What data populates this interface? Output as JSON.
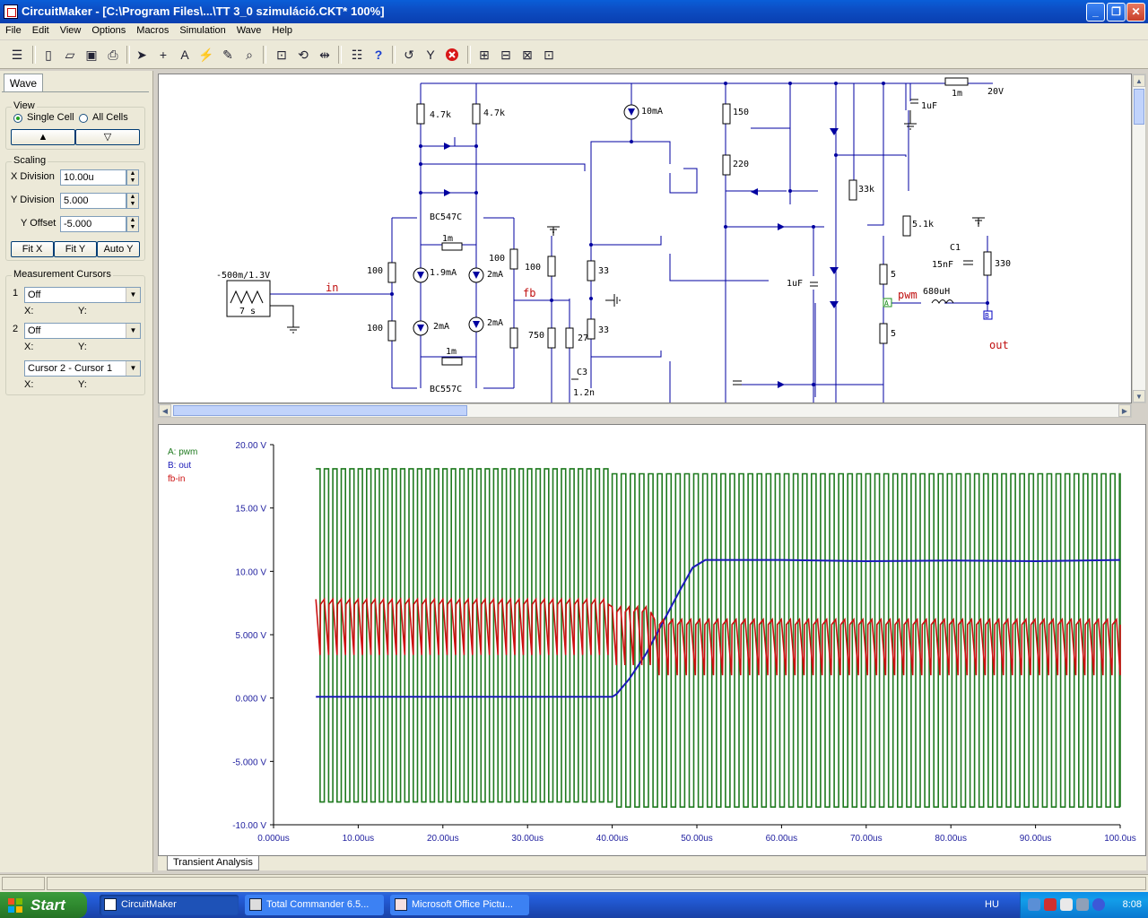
{
  "window": {
    "title": "CircuitMaker - [C:\\Program Files\\...\\TT 3_0 szimuláció.CKT* 100%]",
    "minimize": "_",
    "restore": "❐",
    "close": "✕"
  },
  "menu": [
    "File",
    "Edit",
    "View",
    "Options",
    "Macros",
    "Simulation",
    "Wave",
    "Help"
  ],
  "panel": {
    "tab": "Wave",
    "view": {
      "legend": "View",
      "single_cell": "Single Cell",
      "all_cells": "All Cells",
      "selected": "Single Cell",
      "up": "▲",
      "down": "▽"
    },
    "scaling": {
      "legend": "Scaling",
      "x_division_label": "X Division",
      "x_division": "10.00u",
      "y_division_label": "Y Division",
      "y_division": "5.000",
      "y_offset_label": "Y Offset",
      "y_offset": "-5.000",
      "fit_x": "Fit X",
      "fit_y": "Fit Y",
      "auto_y": "Auto Y"
    },
    "cursors": {
      "legend": "Measurement Cursors",
      "c1_num": "1",
      "c1_value": "Off",
      "c2_num": "2",
      "c2_value": "Off",
      "diff_value": "Cursor 2 - Cursor 1",
      "x_label": "X:",
      "y_label": "Y:"
    }
  },
  "schematic": {
    "labels": [
      "4.7k",
      "4.7k",
      "10mA",
      "150",
      "220",
      "1m",
      "20V",
      "1uF",
      "BC547C",
      "1m",
      "100",
      "1.9mA",
      "2mA",
      "100",
      "100",
      "33",
      "33k",
      "5.1k",
      "1uF",
      "5",
      "C1",
      "15nF",
      "330",
      "-500m/1.3V",
      "7 s",
      "in",
      "fb",
      "100",
      "2mA",
      "2mA",
      "1m",
      "750",
      "27",
      "C3",
      "1.2n",
      "33",
      "BC557C",
      "pwm",
      "680uH",
      "5",
      "out"
    ],
    "probe_a": "A",
    "probe_b": "B"
  },
  "chart_data": {
    "type": "line",
    "title": "",
    "xlabel": "",
    "ylabel": "",
    "x_ticks": [
      "0.000us",
      "10.00us",
      "20.00us",
      "30.00us",
      "40.00us",
      "50.00us",
      "60.00us",
      "70.00us",
      "80.00us",
      "90.00us",
      "100.0us"
    ],
    "y_ticks": [
      "20.00 V",
      "15.00 V",
      "10.00 V",
      "5.000 V",
      "0.000 V",
      "-5.000 V",
      "-10.00 V"
    ],
    "xlim": [
      0,
      100
    ],
    "ylim": [
      -10,
      20
    ],
    "legend_position": "top-left",
    "series": [
      {
        "name": "A: pwm",
        "color": "#1f7a1f",
        "kind": "square",
        "start": 5.0,
        "end": 100,
        "period": 1.0,
        "segments": [
          {
            "from": 5.0,
            "to": 40.0,
            "high": 18.1,
            "low": -8.2,
            "period": 1.0
          },
          {
            "from": 40.0,
            "to": 100,
            "high": 17.7,
            "low": -8.6,
            "period": 1.07
          }
        ]
      },
      {
        "name": "B: out",
        "color": "#1a1ab8",
        "kind": "line",
        "points": [
          [
            5,
            0.1
          ],
          [
            40,
            0.1
          ],
          [
            40.5,
            0.3
          ],
          [
            42,
            1.5
          ],
          [
            44,
            3.5
          ],
          [
            46,
            6.0
          ],
          [
            48,
            8.5
          ],
          [
            49.5,
            10.3
          ],
          [
            51,
            10.9
          ],
          [
            60,
            10.9
          ],
          [
            70,
            10.8
          ],
          [
            80,
            10.85
          ],
          [
            90,
            10.8
          ],
          [
            100,
            10.9
          ]
        ]
      },
      {
        "name": "fb-in",
        "color": "#cc1111",
        "kind": "sawtooth",
        "segments": [
          {
            "from": 5.0,
            "to": 40.0,
            "high": 7.8,
            "low": 3.4,
            "period": 1.0
          },
          {
            "from": 40.0,
            "to": 45.0,
            "high": 7.2,
            "low": 2.6,
            "period": 1.0
          },
          {
            "from": 45.0,
            "to": 100,
            "high": 6.2,
            "low": 1.8,
            "period": 1.07
          }
        ]
      }
    ]
  },
  "bottom_tab": "Transient Analysis",
  "taskbar": {
    "start": "Start",
    "tasks": [
      "CircuitMaker",
      "Total Commander 6.5...",
      "Microsoft Office Pictu..."
    ],
    "language": "HU",
    "clock": "8:08"
  }
}
